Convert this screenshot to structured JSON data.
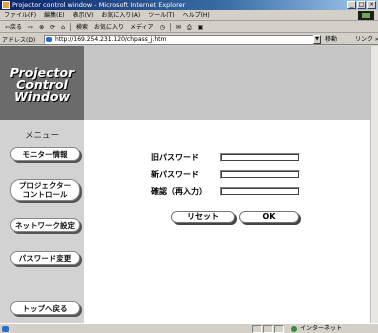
{
  "window": {
    "title": "Projector control window - Microsoft Internet Explorer",
    "controls": [
      "_",
      "□",
      "×"
    ]
  },
  "menubar": {
    "items": [
      "ファイル(F)",
      "編集(E)",
      "表示(V)",
      "お気に入り(A)",
      "ツール(T)",
      "ヘルプ(H)"
    ]
  },
  "toolbar": {
    "back": "⇦戻る",
    "forward": "⇨",
    "stop": "⊗",
    "refresh": "⟳",
    "home": "⌂",
    "search": "検索",
    "favorites": "お気に入り",
    "media": "メディア",
    "history": "◷",
    "mail": "✉",
    "print": "⎙",
    "edit": "▣"
  },
  "address": {
    "label": "アドレス(D)",
    "url": "http://169.254.231.120/chpass_j.htm",
    "go": "移動",
    "links": "リンク »"
  },
  "header": {
    "lines": [
      "Projector",
      "Control",
      "Window"
    ]
  },
  "sidebar": {
    "title": "メニュー",
    "items": [
      {
        "label": "モニター情報"
      },
      {
        "label": "プロジェクター\nコントロール"
      },
      {
        "label": "ネットワーク設定"
      },
      {
        "label": "パスワード変更"
      },
      {
        "label": "トップへ戻る"
      }
    ]
  },
  "form": {
    "old_password_label": "旧パスワード",
    "new_password_label": "新パスワード",
    "confirm_label": "確認（再入力）",
    "reset_label": "リセット",
    "ok_label": "OK"
  },
  "status": {
    "zone": "インターネット"
  }
}
